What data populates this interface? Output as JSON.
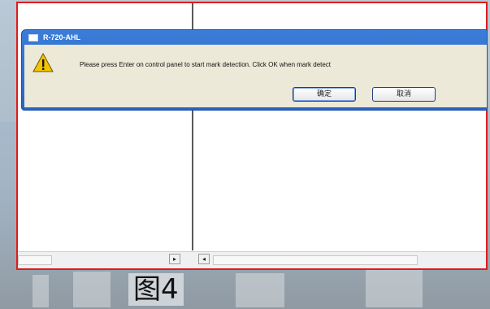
{
  "dialog": {
    "title": "R-720-AHL",
    "message": "Please press Enter on control panel to start mark detection. Click OK when mark detect",
    "ok_label": "确定",
    "cancel_label": "取消",
    "icon": "warning-icon"
  },
  "caption": "图4",
  "colors": {
    "border_highlight": "#e11b1b",
    "titlebar": "#2a63c1",
    "dialog_body": "#ece9d8"
  }
}
